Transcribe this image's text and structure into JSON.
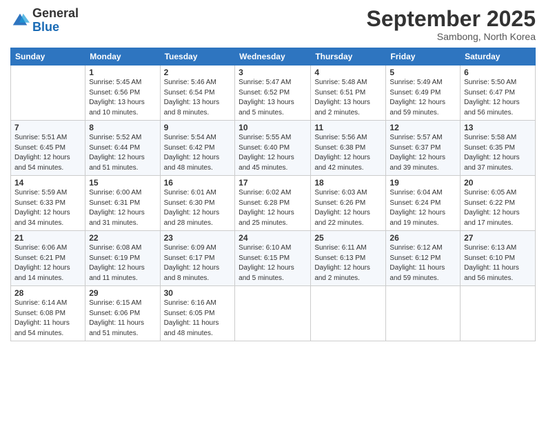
{
  "logo": {
    "general": "General",
    "blue": "Blue"
  },
  "header": {
    "title": "September 2025",
    "subtitle": "Sambong, North Korea"
  },
  "days_of_week": [
    "Sunday",
    "Monday",
    "Tuesday",
    "Wednesday",
    "Thursday",
    "Friday",
    "Saturday"
  ],
  "weeks": [
    [
      {
        "day": "",
        "info": ""
      },
      {
        "day": "1",
        "info": "Sunrise: 5:45 AM\nSunset: 6:56 PM\nDaylight: 13 hours\nand 10 minutes."
      },
      {
        "day": "2",
        "info": "Sunrise: 5:46 AM\nSunset: 6:54 PM\nDaylight: 13 hours\nand 8 minutes."
      },
      {
        "day": "3",
        "info": "Sunrise: 5:47 AM\nSunset: 6:52 PM\nDaylight: 13 hours\nand 5 minutes."
      },
      {
        "day": "4",
        "info": "Sunrise: 5:48 AM\nSunset: 6:51 PM\nDaylight: 13 hours\nand 2 minutes."
      },
      {
        "day": "5",
        "info": "Sunrise: 5:49 AM\nSunset: 6:49 PM\nDaylight: 12 hours\nand 59 minutes."
      },
      {
        "day": "6",
        "info": "Sunrise: 5:50 AM\nSunset: 6:47 PM\nDaylight: 12 hours\nand 56 minutes."
      }
    ],
    [
      {
        "day": "7",
        "info": "Sunrise: 5:51 AM\nSunset: 6:45 PM\nDaylight: 12 hours\nand 54 minutes."
      },
      {
        "day": "8",
        "info": "Sunrise: 5:52 AM\nSunset: 6:44 PM\nDaylight: 12 hours\nand 51 minutes."
      },
      {
        "day": "9",
        "info": "Sunrise: 5:54 AM\nSunset: 6:42 PM\nDaylight: 12 hours\nand 48 minutes."
      },
      {
        "day": "10",
        "info": "Sunrise: 5:55 AM\nSunset: 6:40 PM\nDaylight: 12 hours\nand 45 minutes."
      },
      {
        "day": "11",
        "info": "Sunrise: 5:56 AM\nSunset: 6:38 PM\nDaylight: 12 hours\nand 42 minutes."
      },
      {
        "day": "12",
        "info": "Sunrise: 5:57 AM\nSunset: 6:37 PM\nDaylight: 12 hours\nand 39 minutes."
      },
      {
        "day": "13",
        "info": "Sunrise: 5:58 AM\nSunset: 6:35 PM\nDaylight: 12 hours\nand 37 minutes."
      }
    ],
    [
      {
        "day": "14",
        "info": "Sunrise: 5:59 AM\nSunset: 6:33 PM\nDaylight: 12 hours\nand 34 minutes."
      },
      {
        "day": "15",
        "info": "Sunrise: 6:00 AM\nSunset: 6:31 PM\nDaylight: 12 hours\nand 31 minutes."
      },
      {
        "day": "16",
        "info": "Sunrise: 6:01 AM\nSunset: 6:30 PM\nDaylight: 12 hours\nand 28 minutes."
      },
      {
        "day": "17",
        "info": "Sunrise: 6:02 AM\nSunset: 6:28 PM\nDaylight: 12 hours\nand 25 minutes."
      },
      {
        "day": "18",
        "info": "Sunrise: 6:03 AM\nSunset: 6:26 PM\nDaylight: 12 hours\nand 22 minutes."
      },
      {
        "day": "19",
        "info": "Sunrise: 6:04 AM\nSunset: 6:24 PM\nDaylight: 12 hours\nand 19 minutes."
      },
      {
        "day": "20",
        "info": "Sunrise: 6:05 AM\nSunset: 6:22 PM\nDaylight: 12 hours\nand 17 minutes."
      }
    ],
    [
      {
        "day": "21",
        "info": "Sunrise: 6:06 AM\nSunset: 6:21 PM\nDaylight: 12 hours\nand 14 minutes."
      },
      {
        "day": "22",
        "info": "Sunrise: 6:08 AM\nSunset: 6:19 PM\nDaylight: 12 hours\nand 11 minutes."
      },
      {
        "day": "23",
        "info": "Sunrise: 6:09 AM\nSunset: 6:17 PM\nDaylight: 12 hours\nand 8 minutes."
      },
      {
        "day": "24",
        "info": "Sunrise: 6:10 AM\nSunset: 6:15 PM\nDaylight: 12 hours\nand 5 minutes."
      },
      {
        "day": "25",
        "info": "Sunrise: 6:11 AM\nSunset: 6:13 PM\nDaylight: 12 hours\nand 2 minutes."
      },
      {
        "day": "26",
        "info": "Sunrise: 6:12 AM\nSunset: 6:12 PM\nDaylight: 11 hours\nand 59 minutes."
      },
      {
        "day": "27",
        "info": "Sunrise: 6:13 AM\nSunset: 6:10 PM\nDaylight: 11 hours\nand 56 minutes."
      }
    ],
    [
      {
        "day": "28",
        "info": "Sunrise: 6:14 AM\nSunset: 6:08 PM\nDaylight: 11 hours\nand 54 minutes."
      },
      {
        "day": "29",
        "info": "Sunrise: 6:15 AM\nSunset: 6:06 PM\nDaylight: 11 hours\nand 51 minutes."
      },
      {
        "day": "30",
        "info": "Sunrise: 6:16 AM\nSunset: 6:05 PM\nDaylight: 11 hours\nand 48 minutes."
      },
      {
        "day": "",
        "info": ""
      },
      {
        "day": "",
        "info": ""
      },
      {
        "day": "",
        "info": ""
      },
      {
        "day": "",
        "info": ""
      }
    ]
  ]
}
